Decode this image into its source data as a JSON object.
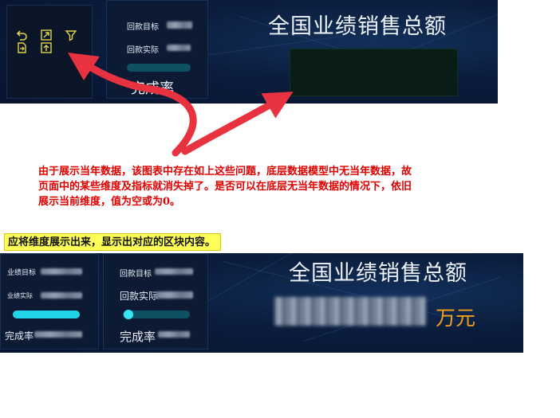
{
  "top_panel": {
    "title": "全国业绩销售总额",
    "collection_target_label": "回款目标",
    "collection_actual_label": "回款实际",
    "completion_rate_label": "完成率",
    "toolbar_icons": [
      "undo-icon",
      "maximize-icon",
      "filter-icon",
      "export-icon",
      "upload-icon"
    ]
  },
  "annotation": {
    "text": "由于展示当年数据，该图表中存在如上这些问题，底层数据模型中无当年数据，故页面中的某些维度及指标就消失掉了。是否可以在底层无当年数据的情况下，依旧展示当前维度，值为空或为0。",
    "note": "应将维度展示出来，显示出对应的区块内容。"
  },
  "bottom_panel": {
    "title": "全国业绩销售总额",
    "sales_target_label": "业绩目标",
    "sales_actual_label": "业绩实际",
    "completion_rate_label_left": "完成率",
    "collection_target_label": "回款目标",
    "collection_actual_label": "回款实际",
    "completion_rate_label_right": "完成率",
    "unit": "万元"
  },
  "colors": {
    "panel_bg": "#0b1d3d",
    "annotation_red": "#e00000",
    "arrow_red": "#e8323f",
    "highlight_yellow": "#ffff5a",
    "unit_orange": "#f0a020",
    "progress_cyan": "#22d4e8"
  }
}
